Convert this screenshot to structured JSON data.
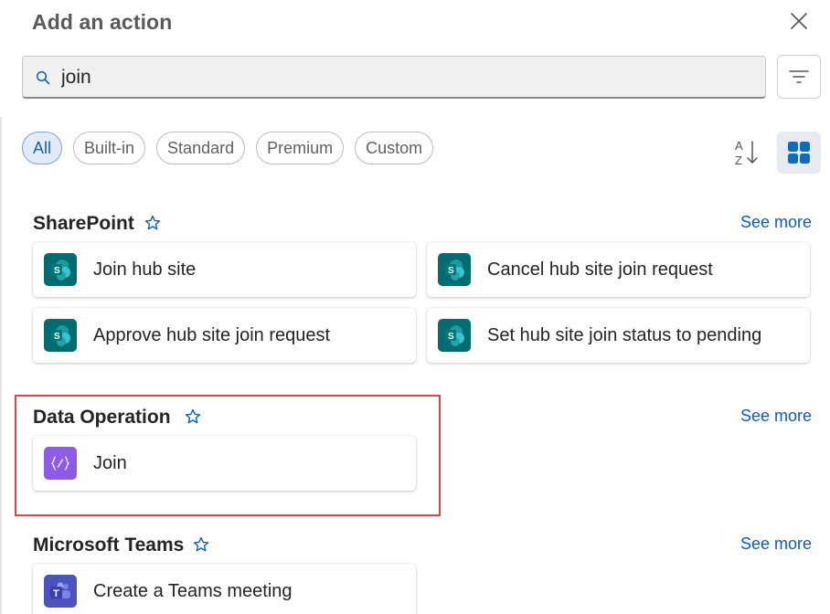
{
  "header": {
    "title": "Add an action",
    "close_icon": "close-icon"
  },
  "search": {
    "value": "join",
    "placeholder": "Search for an action or connector",
    "icon": "search-icon"
  },
  "filter_button": {
    "icon": "filter-icon"
  },
  "filter_pills": [
    {
      "label": "All",
      "active": true
    },
    {
      "label": "Built-in",
      "active": false
    },
    {
      "label": "Standard",
      "active": false
    },
    {
      "label": "Premium",
      "active": false
    },
    {
      "label": "Custom",
      "active": false
    }
  ],
  "view_controls": {
    "sort_icon": "sort-a-z-icon",
    "grid_icon": "grid-view-icon"
  },
  "sections": [
    {
      "name": "SharePoint",
      "see_more": "See more",
      "actions": [
        {
          "label": "Join hub site"
        },
        {
          "label": "Cancel hub site join request"
        },
        {
          "label": "Approve hub site join request"
        },
        {
          "label": "Set hub site join status to pending"
        }
      ]
    },
    {
      "name": "Data Operation",
      "see_more": "See more",
      "actions": [
        {
          "label": "Join"
        }
      ]
    },
    {
      "name": "Microsoft Teams",
      "see_more": "See more",
      "actions": [
        {
          "label": "Create a Teams meeting"
        }
      ]
    }
  ],
  "colors": {
    "accent": "#0f5cb8",
    "sharepoint_tile": "#036c70",
    "data_operation_tile": "#8d5be8",
    "teams_tile": "#4b53bc",
    "highlight_border": "#e0434b"
  }
}
